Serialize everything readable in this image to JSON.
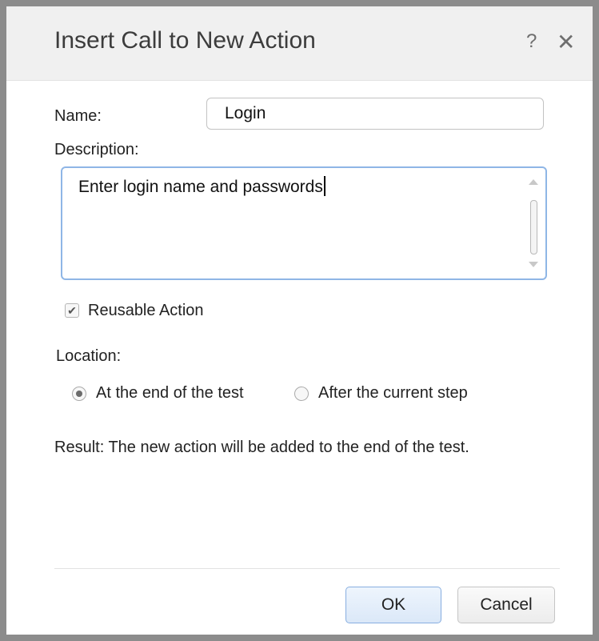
{
  "dialog": {
    "title": "Insert Call to New Action",
    "help_glyph": "?",
    "close_glyph": "✕"
  },
  "form": {
    "name_label": "Name:",
    "name_value": "Login",
    "description_label": "Description:",
    "description_value": "Enter login name and passwords",
    "reusable_label": "Reusable Action",
    "reusable_checked": true,
    "location_label": "Location:",
    "location_options": [
      {
        "label": "At the end of the test",
        "selected": true
      },
      {
        "label": "After the current step",
        "selected": false
      }
    ],
    "result_text": "Result: The new action will be added to the end of the test."
  },
  "buttons": {
    "ok": "OK",
    "cancel": "Cancel"
  },
  "icons": {
    "help": "help-icon",
    "close": "close-icon",
    "check": "checkmark-icon"
  },
  "colors": {
    "focus_border": "#8fb6e6",
    "ok_border": "#88aee0"
  }
}
